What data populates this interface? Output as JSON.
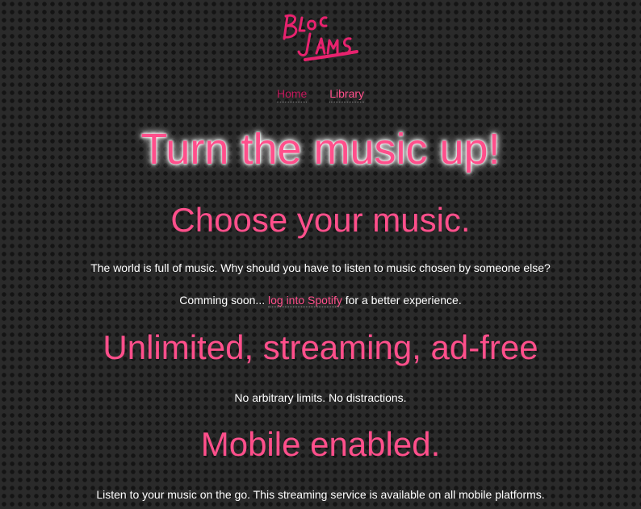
{
  "logo": {
    "text": "Bloc Jams",
    "color": "#e8226e"
  },
  "nav": {
    "home_label": "Home",
    "library_label": "Library"
  },
  "hero": {
    "title": "Turn the music up!"
  },
  "selling_points": [
    {
      "title": "Choose your music.",
      "description": "The world is full of music. Why should you have to listen to music chosen by someone else?",
      "spotify_prefix": "Comming soon... ",
      "spotify_link": "log into Spotify",
      "spotify_suffix": " for a better experience."
    },
    {
      "title": "Unlimited, streaming, ad-free",
      "description": "No arbitrary limits. No distractions."
    },
    {
      "title": "Mobile enabled.",
      "description": "Listen to your music on the go. This streaming service is available on all mobile platforms."
    }
  ],
  "colors": {
    "accent": "#ff4f8b",
    "nav_home": "#c2185b",
    "background": "#2a2a2a",
    "text": "#ffffff"
  }
}
